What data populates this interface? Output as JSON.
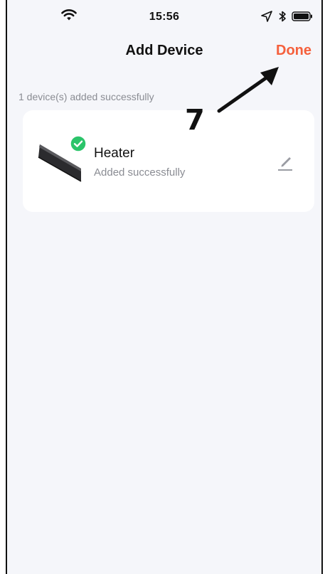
{
  "status_bar": {
    "time": "15:56",
    "icons": [
      "wifi-icon",
      "location-arrow-icon",
      "bluetooth-icon",
      "battery-icon"
    ]
  },
  "nav": {
    "title": "Add Device",
    "done_label": "Done"
  },
  "summary_text": "1 device(s) added successfully",
  "devices": [
    {
      "name": "Heater",
      "status": "Added successfully",
      "icons": [
        "device-image",
        "success-check-icon",
        "edit-icon"
      ]
    }
  ],
  "annotation": {
    "step_number": "7"
  },
  "colors": {
    "accent": "#f5603c",
    "success": "#2bc46a",
    "background": "#f5f6fa",
    "card": "#ffffff",
    "muted_text": "#8a8c93"
  }
}
